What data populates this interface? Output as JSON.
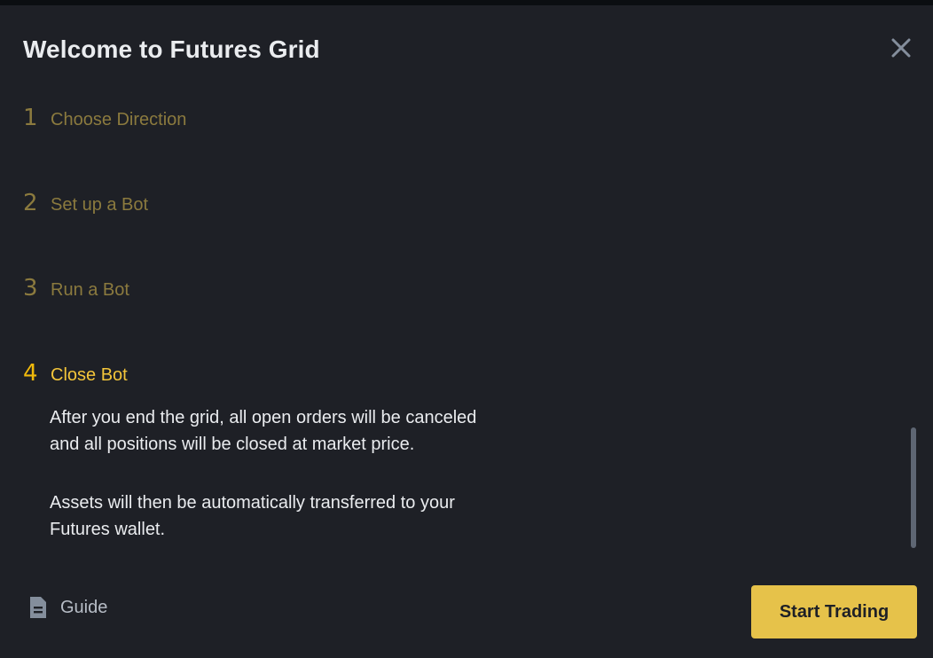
{
  "modal": {
    "title": "Welcome to Futures Grid",
    "close_icon": "close-icon"
  },
  "steps": [
    {
      "number": "1",
      "label": "Choose Direction",
      "active": false
    },
    {
      "number": "2",
      "label": "Set up a Bot",
      "active": false
    },
    {
      "number": "3",
      "label": "Run a Bot",
      "active": false
    },
    {
      "number": "4",
      "label": "Close Bot",
      "active": true
    }
  ],
  "active_step": {
    "paragraphs": [
      "After you end the grid, all open orders will be canceled and all positions will be closed at market price.",
      "Assets will then be automatically transferred to your Futures wallet."
    ]
  },
  "footer": {
    "guide_label": "Guide",
    "guide_icon": "document-icon",
    "start_button_label": "Start Trading"
  },
  "colors": {
    "background": "#1e2026",
    "accent": "#f0b90b",
    "inactive_step": "#8b7a3e",
    "button": "#e6c24a",
    "text": "#eaecef"
  }
}
